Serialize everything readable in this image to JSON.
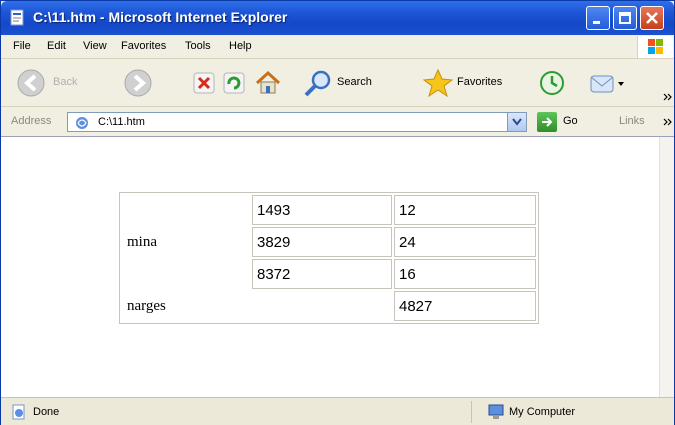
{
  "window": {
    "title": "C:\\11.htm - Microsoft Internet Explorer"
  },
  "menu": {
    "items": [
      {
        "label": "File"
      },
      {
        "label": "Edit"
      },
      {
        "label": "View"
      },
      {
        "label": "Favorites"
      },
      {
        "label": "Tools"
      },
      {
        "label": "Help"
      }
    ]
  },
  "toolbar": {
    "back_label": "Back",
    "search_label": "Search",
    "favorites_label": "Favorites"
  },
  "address": {
    "label": "Address",
    "value": "C:\\11.htm",
    "go_label": "Go",
    "links_label": "Links"
  },
  "table": {
    "rows": [
      {
        "name": "mina",
        "values": [
          [
            "1493",
            "12"
          ],
          [
            "3829",
            "24"
          ],
          [
            "8372",
            "16"
          ]
        ]
      },
      {
        "name": "narges",
        "value": "4827"
      }
    ]
  },
  "status": {
    "text": "Done",
    "zone": "My Computer"
  },
  "colors": {
    "titlebar": "#1c55d6",
    "close_button": "#c6401c",
    "toolbar_bg": "#f1efe2"
  }
}
